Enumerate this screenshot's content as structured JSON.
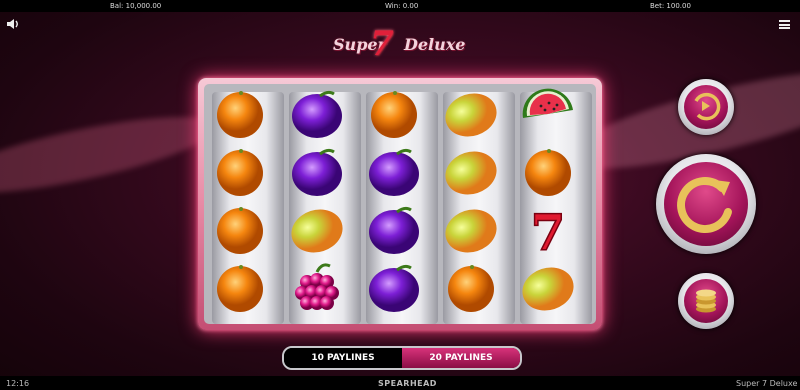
{
  "topbar": {
    "balance": "Bal: 10,000.00",
    "win": "Win: 0.00",
    "bet": "Bet: 100.00"
  },
  "title": {
    "left": "Super",
    "seven": "7",
    "right": "Deluxe"
  },
  "reels": [
    [
      "orange",
      "orange",
      "orange",
      "orange"
    ],
    [
      "plum",
      "plum",
      "lemon",
      "grapes"
    ],
    [
      "orange",
      "plum",
      "plum",
      "plum"
    ],
    [
      "lemon",
      "lemon",
      "lemon",
      "orange"
    ],
    [
      "watermelon",
      "orange",
      "seven",
      "lemon"
    ]
  ],
  "paylines": {
    "option1": "10 PAYLINES",
    "option2": "20 PAYLINES",
    "selected": "10 PAYLINES"
  },
  "bottombar": {
    "time": "12:16",
    "brand": "SPEARHEAD",
    "game": "Super 7 Deluxe"
  },
  "colors": {
    "accent": "#d8327a",
    "frame_glow": "#ff3f7a",
    "orange": "#f07a10",
    "plum": "#7a1ad0",
    "lemon": "#c8d23a"
  },
  "icons": {
    "sound": "speaker-icon",
    "menu": "hamburger-menu-icon",
    "autoplay": "autoplay-icon",
    "spin": "spin-icon",
    "bet": "coin-stack-icon"
  }
}
